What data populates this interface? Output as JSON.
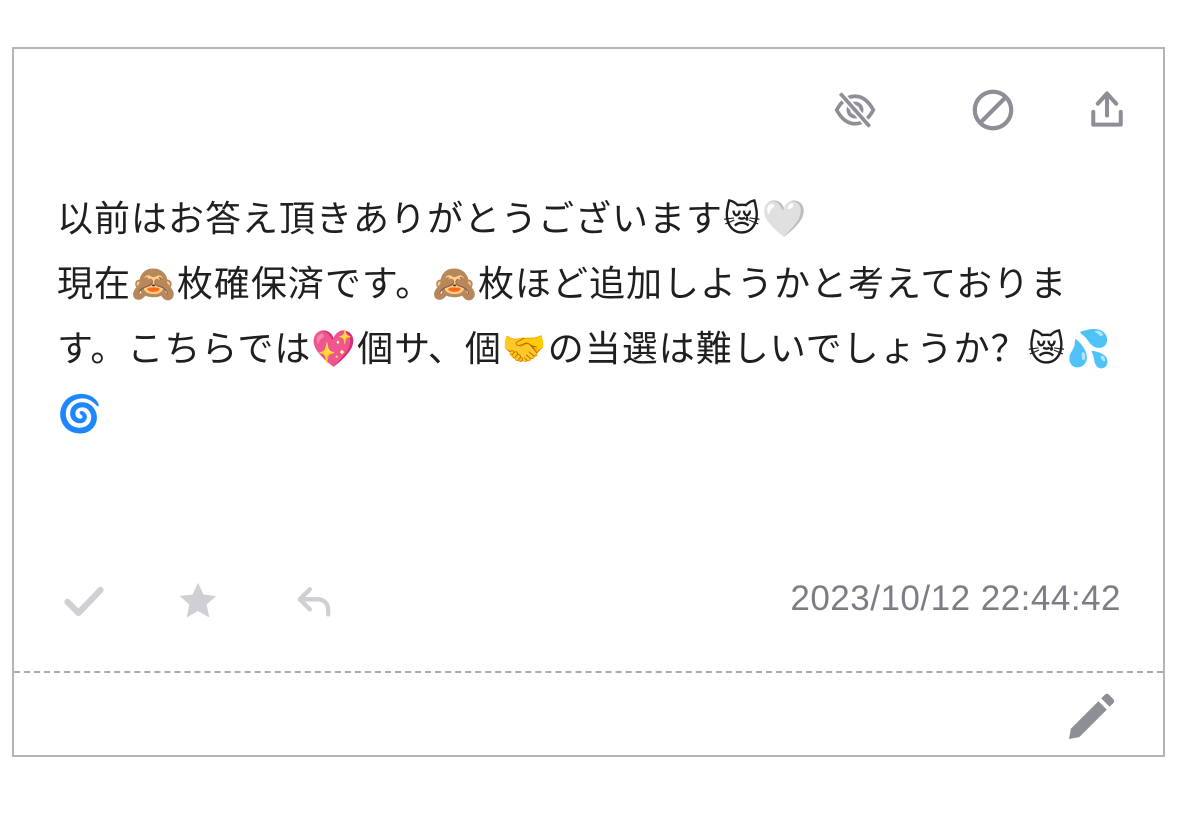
{
  "post": {
    "message": "以前はお答え頂きありがとうございます😿🤍\n現在🙈枚確保済です。🙈枚ほど追加しようかと考えております。こちらでは💖個サ、個🤝の当選は難しいでしょうか？😿💦🌀",
    "timestamp": "2023/10/12 22:44:42"
  },
  "toolbar_top": {
    "items": [
      {
        "icon": "eye-off-icon",
        "action": "hide"
      },
      {
        "icon": "block-icon",
        "action": "block"
      },
      {
        "icon": "share-icon",
        "action": "share"
      }
    ]
  },
  "actions_bottom": {
    "items": [
      {
        "icon": "check-icon",
        "action": "mark-done"
      },
      {
        "icon": "star-icon",
        "action": "favorite"
      },
      {
        "icon": "reply-icon",
        "action": "reply"
      }
    ]
  },
  "footer": {
    "edit_icon": "pencil-icon"
  },
  "colors": {
    "icon_dark": "#8e8e96",
    "icon_light": "#cfcfd4",
    "border": "#b4b4bd",
    "text": "#1f1f1f",
    "timestamp": "#7d7d86"
  }
}
